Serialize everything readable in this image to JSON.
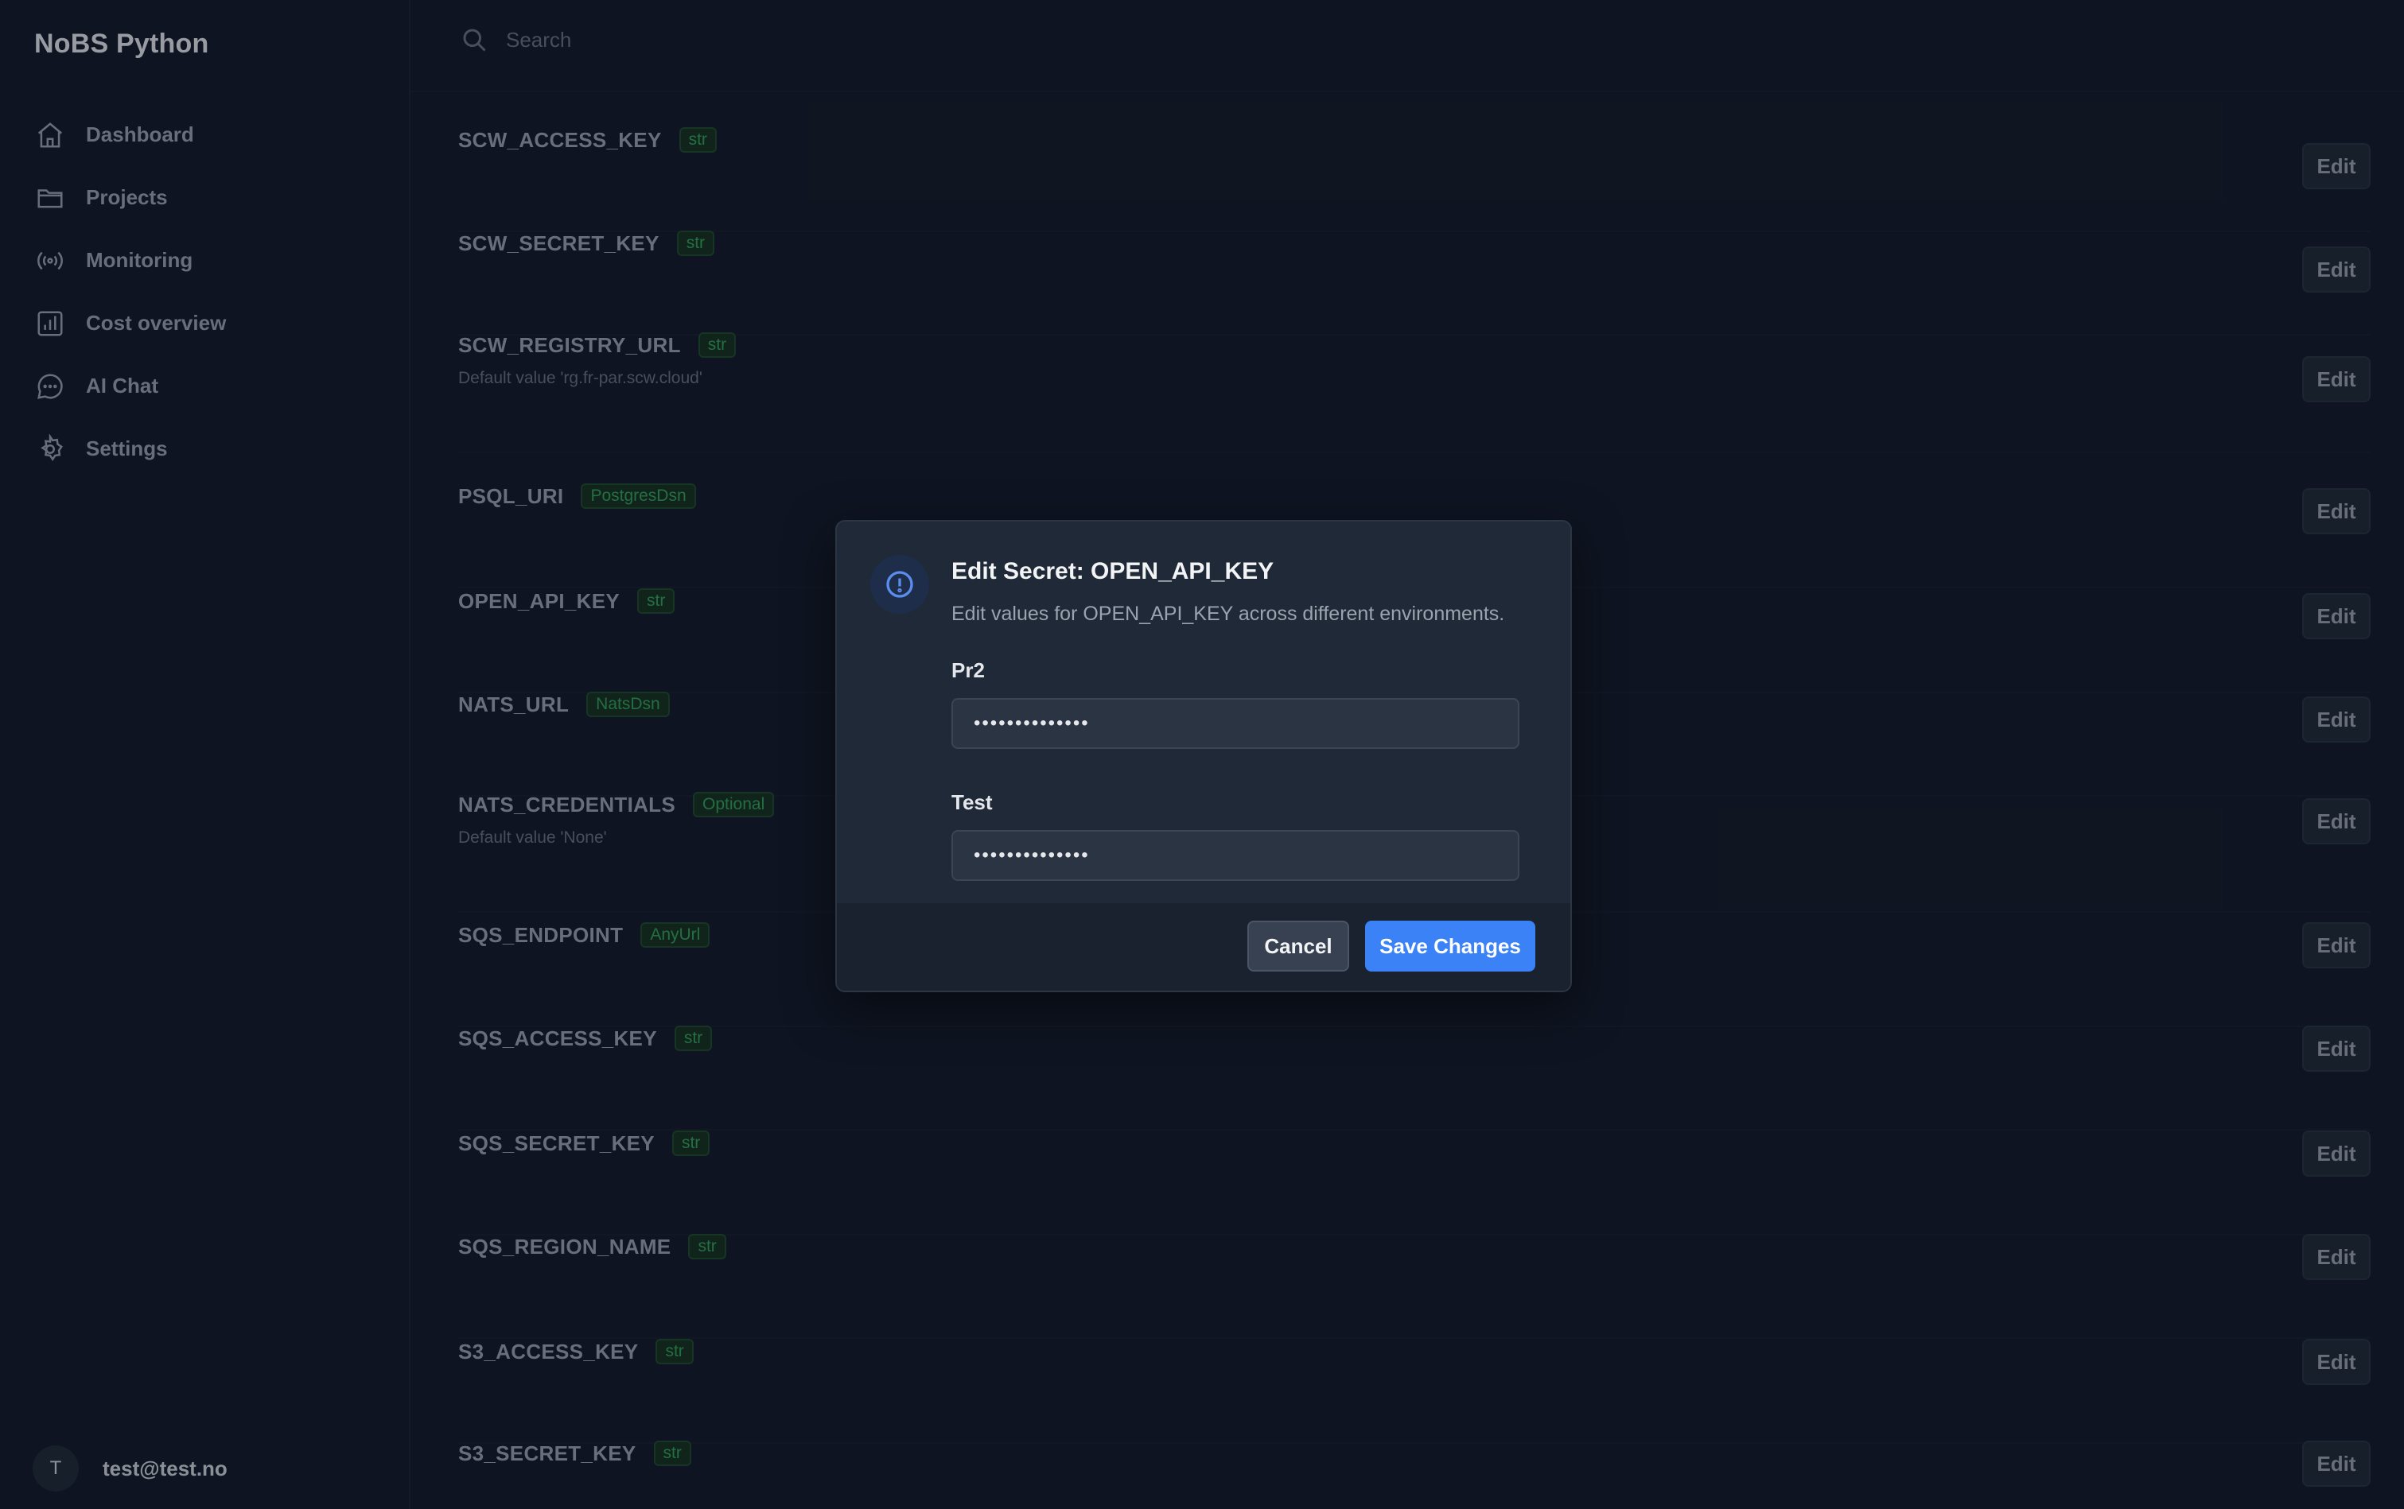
{
  "app": {
    "brand": "NoBS Python"
  },
  "sidebar": {
    "items": [
      {
        "label": "Dashboard",
        "icon": "home-icon"
      },
      {
        "label": "Projects",
        "icon": "folder-icon"
      },
      {
        "label": "Monitoring",
        "icon": "broadcast-icon"
      },
      {
        "label": "Cost overview",
        "icon": "bar-chart-icon"
      },
      {
        "label": "AI Chat",
        "icon": "chat-bubble-icon"
      },
      {
        "label": "Settings",
        "icon": "gear-icon"
      }
    ],
    "user": {
      "initial": "T",
      "email": "test@test.no"
    }
  },
  "search": {
    "placeholder": "Search"
  },
  "secrets": {
    "edit_label": "Edit",
    "rows": [
      {
        "name": "SCW_ACCESS_KEY",
        "type": "str",
        "default": ""
      },
      {
        "name": "SCW_SECRET_KEY",
        "type": "str",
        "default": ""
      },
      {
        "name": "SCW_REGISTRY_URL",
        "type": "str",
        "default": "Default value 'rg.fr-par.scw.cloud'"
      },
      {
        "name": "PSQL_URI",
        "type": "PostgresDsn",
        "default": ""
      },
      {
        "name": "OPEN_API_KEY",
        "type": "str",
        "default": ""
      },
      {
        "name": "NATS_URL",
        "type": "NatsDsn",
        "default": ""
      },
      {
        "name": "NATS_CREDENTIALS",
        "type": "Optional",
        "default": "Default value 'None'"
      },
      {
        "name": "SQS_ENDPOINT",
        "type": "AnyUrl",
        "default": ""
      },
      {
        "name": "SQS_ACCESS_KEY",
        "type": "str",
        "default": ""
      },
      {
        "name": "SQS_SECRET_KEY",
        "type": "str",
        "default": ""
      },
      {
        "name": "SQS_REGION_NAME",
        "type": "str",
        "default": ""
      },
      {
        "name": "S3_ACCESS_KEY",
        "type": "str",
        "default": ""
      },
      {
        "name": "S3_SECRET_KEY",
        "type": "str",
        "default": ""
      }
    ]
  },
  "modal": {
    "title": "Edit Secret: OPEN_API_KEY",
    "description": "Edit values for OPEN_API_KEY across different environments.",
    "fields": [
      {
        "label": "Pr2",
        "value": "••••••••••••••"
      },
      {
        "label": "Test",
        "value": "••••••••••••••"
      }
    ],
    "cancel_label": "Cancel",
    "save_label": "Save Changes"
  },
  "colors": {
    "accent": "#3b82f6",
    "badge_text": "#34a35a",
    "background": "#111827"
  }
}
